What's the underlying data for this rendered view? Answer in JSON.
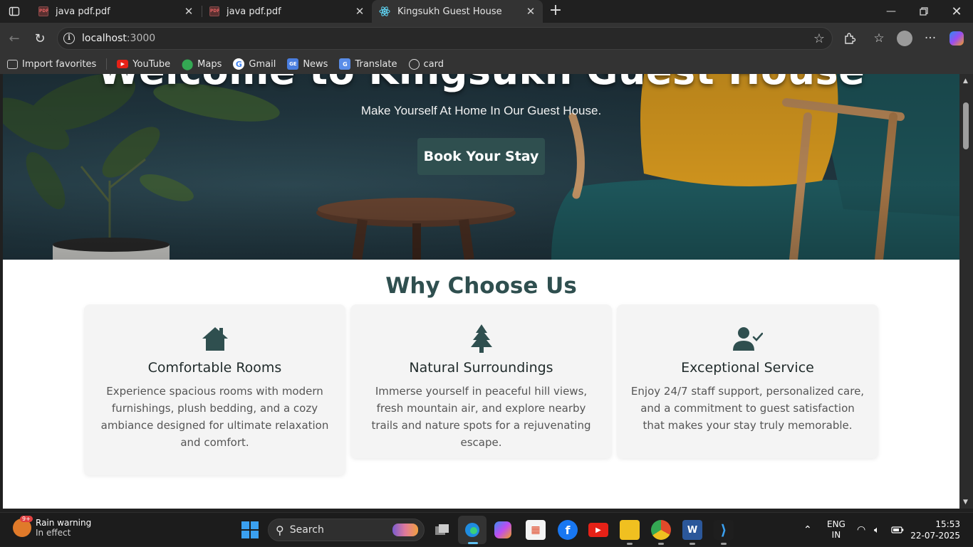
{
  "browser": {
    "tabs": [
      {
        "title": "java pdf.pdf",
        "icon": "pdf-icon"
      },
      {
        "title": "java pdf.pdf",
        "icon": "pdf-icon"
      },
      {
        "title": "Kingsukh Guest House",
        "icon": "react-icon",
        "active": true
      }
    ],
    "url_host": "localhost",
    "url_port": ":3000",
    "bookmarks": [
      {
        "label": "Import favorites",
        "icon": "import-icon"
      },
      {
        "label": "YouTube",
        "icon": "youtube-icon"
      },
      {
        "label": "Maps",
        "icon": "maps-icon"
      },
      {
        "label": "Gmail",
        "icon": "google-icon"
      },
      {
        "label": "News",
        "icon": "news-icon"
      },
      {
        "label": "Translate",
        "icon": "translate-icon"
      },
      {
        "label": "card",
        "icon": "globe-icon"
      }
    ]
  },
  "hero": {
    "title": "Welcome to Kingsukh Guest House",
    "subtitle": "Make Yourself At Home In Our Guest House.",
    "cta": "Book Your Stay"
  },
  "features": {
    "heading": "Why Choose Us",
    "cards": [
      {
        "icon": "house-icon",
        "title": "Comfortable Rooms",
        "text": "Experience spacious rooms with modern furnishings, plush bedding, and a cozy ambiance designed for ultimate relaxation and comfort."
      },
      {
        "icon": "tree-icon",
        "title": "Natural Surroundings",
        "text": "Immerse yourself in peaceful hill views, fresh mountain air, and explore nearby trails and nature spots for a rejuvenating escape."
      },
      {
        "icon": "user-check-icon",
        "title": "Exceptional Service",
        "text": "Enjoy 24/7 staff support, personalized care, and a commitment to guest satisfaction that makes your stay truly memorable."
      }
    ]
  },
  "taskbar": {
    "weather_title": "Rain warning",
    "weather_sub": "In effect",
    "weather_badge": "9+",
    "search_label": "Search",
    "lang_top": "ENG",
    "lang_bottom": "IN",
    "time": "15:53",
    "date": "22-07-2025"
  },
  "colors": {
    "accent": "#2f4f4f",
    "card_bg": "#f4f4f4"
  }
}
